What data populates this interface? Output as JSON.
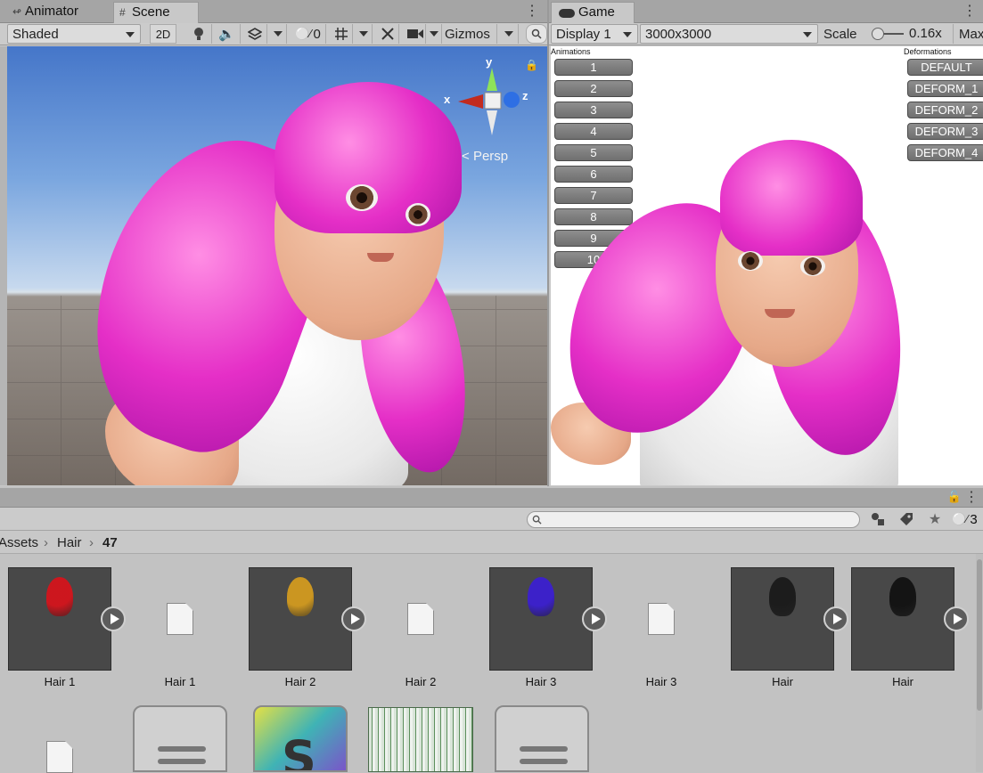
{
  "scene_panel": {
    "tabs": [
      {
        "label": "Animator",
        "icon": "animator-icon"
      },
      {
        "label": "Scene",
        "icon": "grid-icon"
      }
    ],
    "toolbar": {
      "shading_mode": "Shaded",
      "mode_2d": "2D",
      "hidden_count": "0",
      "gizmos_label": "Gizmos"
    },
    "gizmo": {
      "x_label": "x",
      "y_label": "y",
      "z_label": "z",
      "projection": "Persp"
    }
  },
  "game_panel": {
    "tab_label": "Game",
    "display": "Display 1",
    "resolution": "3000x3000",
    "scale_label": "Scale",
    "scale_value": "0.16x",
    "maximize_label": "Max",
    "animations_title": "Animations",
    "animation_buttons": [
      "1",
      "2",
      "3",
      "4",
      "5",
      "6",
      "7",
      "8",
      "9",
      "10"
    ],
    "deformations_title": "Deformations",
    "deformation_buttons": [
      "DEFAULT",
      "DEFORM_1",
      "DEFORM_2",
      "DEFORM_3",
      "DEFORM_4"
    ]
  },
  "project_panel": {
    "search_placeholder": "",
    "hidden_count": "3",
    "breadcrumb": [
      "Assets",
      "Hair",
      "47"
    ],
    "assets": [
      {
        "label": "Hair 1",
        "type": "model",
        "color": "#d4141c"
      },
      {
        "label": "Hair 1",
        "type": "file"
      },
      {
        "label": "Hair 2",
        "type": "model",
        "color": "#d29a1f"
      },
      {
        "label": "Hair 2",
        "type": "file"
      },
      {
        "label": "Hair 3",
        "type": "model",
        "color": "#3b1fd0"
      },
      {
        "label": "Hair 3",
        "type": "file"
      },
      {
        "label": "Hair",
        "type": "model",
        "color": "#1a1a1a"
      },
      {
        "label": "Hair",
        "type": "model",
        "color": "#111111"
      }
    ]
  }
}
